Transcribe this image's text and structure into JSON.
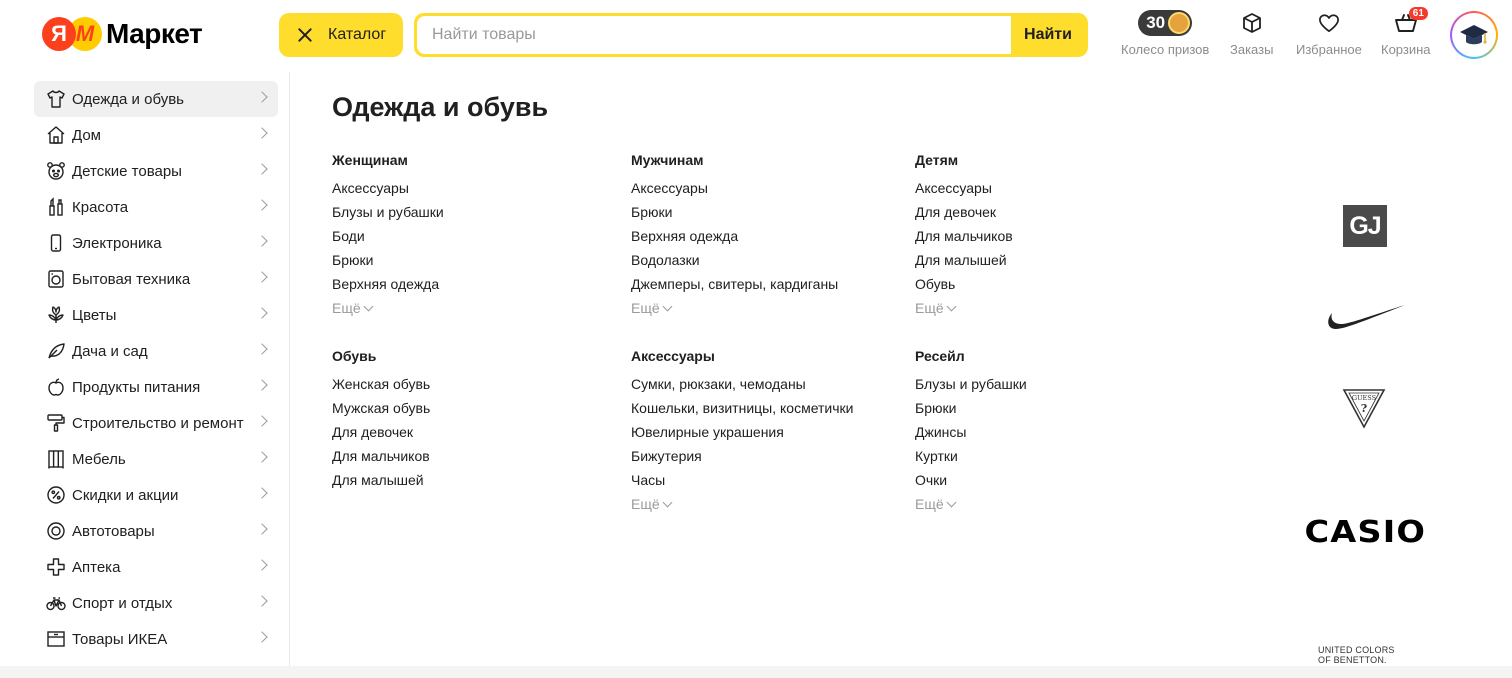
{
  "header": {
    "logo_text": "Маркет",
    "logo_letter": "Я",
    "catalog_label": "Каталог",
    "search_placeholder": "Найти товары",
    "search_button": "Найти",
    "prize_wheel": {
      "count": "30",
      "label": "Колесо призов"
    },
    "orders_label": "Заказы",
    "favorites_label": "Избранное",
    "cart": {
      "label": "Корзина",
      "count": "61"
    }
  },
  "sidebar": {
    "items": [
      {
        "label": "Одежда и обувь",
        "icon": "tshirt-icon",
        "active": true
      },
      {
        "label": "Дом",
        "icon": "house-icon"
      },
      {
        "label": "Детские товары",
        "icon": "teddy-bear-icon"
      },
      {
        "label": "Красота",
        "icon": "cosmetics-icon"
      },
      {
        "label": "Электроника",
        "icon": "smartphone-icon"
      },
      {
        "label": "Бытовая техника",
        "icon": "washing-machine-icon"
      },
      {
        "label": "Цветы",
        "icon": "flower-icon"
      },
      {
        "label": "Дача и сад",
        "icon": "leaf-icon"
      },
      {
        "label": "Продукты питания",
        "icon": "apple-icon"
      },
      {
        "label": "Строительство и ремонт",
        "icon": "paint-roller-icon"
      },
      {
        "label": "Мебель",
        "icon": "wardrobe-icon"
      },
      {
        "label": "Скидки и акции",
        "icon": "percent-icon"
      },
      {
        "label": "Автотовары",
        "icon": "tire-icon"
      },
      {
        "label": "Аптека",
        "icon": "medical-cross-icon"
      },
      {
        "label": "Спорт и отдых",
        "icon": "bicycle-icon"
      },
      {
        "label": "Товары ИКЕА",
        "icon": "box-icon"
      }
    ]
  },
  "main": {
    "title": "Одежда и обувь",
    "more_label": "Ещё",
    "groups": [
      {
        "title": "Женщинам",
        "links": [
          "Аксессуары",
          "Блузы и рубашки",
          "Боди",
          "Брюки",
          "Верхняя одежда"
        ],
        "has_more": true
      },
      {
        "title": "Мужчинам",
        "links": [
          "Аксессуары",
          "Брюки",
          "Верхняя одежда",
          "Водолазки",
          "Джемперы, свитеры, кардиганы"
        ],
        "has_more": true
      },
      {
        "title": "Детям",
        "links": [
          "Аксессуары",
          "Для девочек",
          "Для мальчиков",
          "Для малышей",
          "Обувь"
        ],
        "has_more": true
      },
      {
        "title": "Обувь",
        "links": [
          "Женская обувь",
          "Мужская обувь",
          "Для девочек",
          "Для мальчиков",
          "Для малышей"
        ],
        "has_more": false
      },
      {
        "title": "Аксессуары",
        "links": [
          "Сумки, рюкзаки, чемоданы",
          "Кошельки, визитницы, косметички",
          "Ювелирные украшения",
          "Бижутерия",
          "Часы"
        ],
        "has_more": true
      },
      {
        "title": "Ресейл",
        "links": [
          "Блузы и рубашки",
          "Брюки",
          "Джинсы",
          "Куртки",
          "Очки"
        ],
        "has_more": true
      }
    ]
  },
  "brands": {
    "gj": "GJ",
    "nike": "nike-swoosh-logo",
    "guess": "GUESS",
    "casio": "CASIO",
    "benetton_line1": "UNITED COLORS",
    "benetton_line2": "OF BENETTON."
  }
}
